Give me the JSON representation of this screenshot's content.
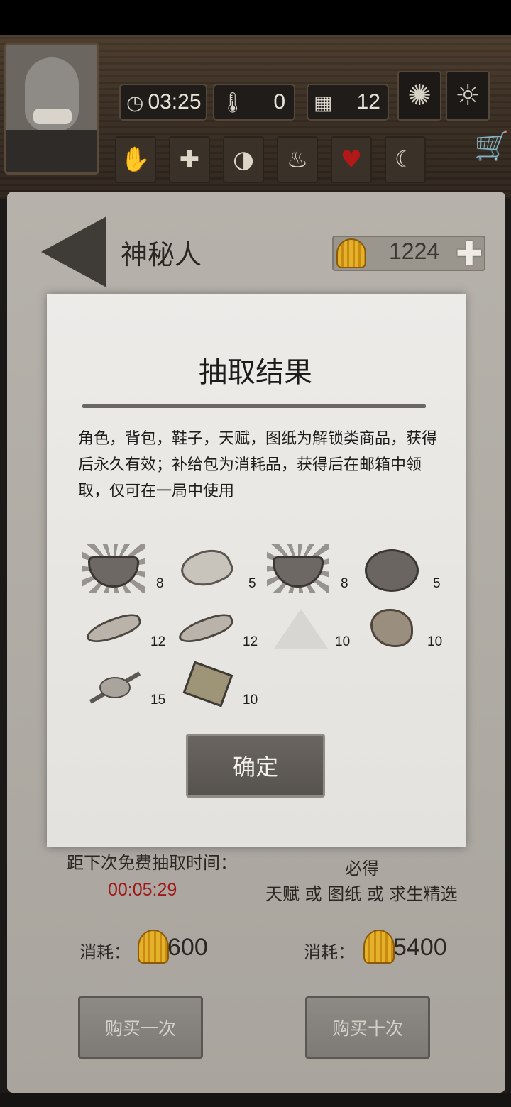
{
  "hud": {
    "time": "03:25",
    "temperature": "0",
    "day": "12",
    "season_icon": "maple-leaf-icon",
    "weather_icon": "sun-icon"
  },
  "status_icons": [
    "hand-icon",
    "plus-icon",
    "stomach-icon",
    "brain-icon",
    "heart-icon",
    "moon-icon"
  ],
  "page": {
    "title": "神秘人",
    "currency": "1224"
  },
  "dialog": {
    "title": "抽取结果",
    "description": "角色，背包，鞋子，天赋，图纸为解锁类商品，获得后永久有效；补给包为消耗品，获得后在邮箱中领取，仅可在一局中使用",
    "items": [
      {
        "name": "bowl",
        "count": "8"
      },
      {
        "name": "ginseng-root",
        "count": "5"
      },
      {
        "name": "bowl",
        "count": "8"
      },
      {
        "name": "meat-dish",
        "count": "5"
      },
      {
        "name": "dried-fish",
        "count": "12"
      },
      {
        "name": "dried-fish",
        "count": "12"
      },
      {
        "name": "salt",
        "count": "10"
      },
      {
        "name": "rock",
        "count": "10"
      },
      {
        "name": "herb",
        "count": "15"
      },
      {
        "name": "paper",
        "count": "10"
      }
    ],
    "confirm_label": "确定"
  },
  "footer": {
    "free_draw_label": "距下次免费抽取时间：",
    "free_draw_timer": "00:05:29",
    "guarantee_label": "必得",
    "guarantee_desc": "天赋 或 图纸 或 求生精选",
    "cost_label": "消耗：",
    "cost_single": "600",
    "cost_ten": "5400",
    "buy_once_label": "购买一次",
    "buy_ten_label": "购买十次"
  },
  "colors": {
    "timer": "#a01818",
    "shell": "#e4b22a"
  }
}
